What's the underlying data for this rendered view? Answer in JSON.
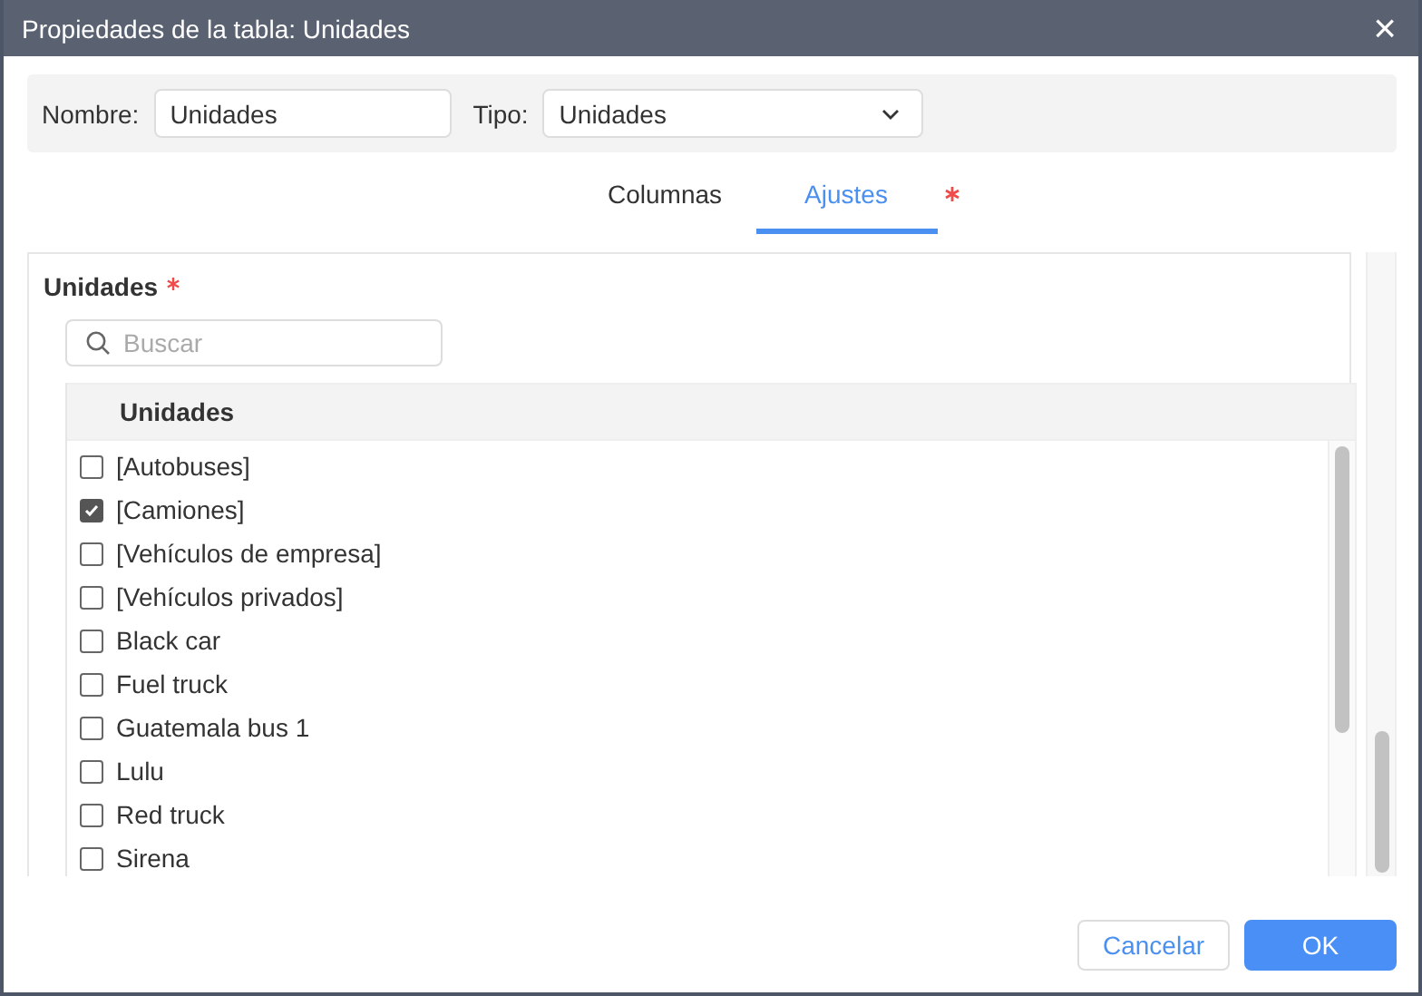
{
  "window": {
    "title": "Propiedades de la tabla: Unidades",
    "close": "×"
  },
  "fields": {
    "name_label": "Nombre:",
    "name_value": "Unidades",
    "type_label": "Tipo:",
    "type_value": "Unidades"
  },
  "tabs": [
    {
      "label": "Columnas",
      "selected": false,
      "required": false
    },
    {
      "label": "Ajustes",
      "selected": true,
      "required": true
    }
  ],
  "section": {
    "title": "Unidades",
    "required": true
  },
  "search": {
    "placeholder": "Buscar"
  },
  "table": {
    "column": "Unidades",
    "rows": [
      {
        "label": "[Autobuses]",
        "checked": false
      },
      {
        "label": "[Camiones]",
        "checked": true
      },
      {
        "label": "[Vehículos de empresa]",
        "checked": false
      },
      {
        "label": "[Vehículos privados]",
        "checked": false
      },
      {
        "label": "Black car",
        "checked": false
      },
      {
        "label": "Fuel truck",
        "checked": false
      },
      {
        "label": "Guatemala bus 1",
        "checked": false
      },
      {
        "label": "Lulu",
        "checked": false
      },
      {
        "label": "Red truck",
        "checked": false
      },
      {
        "label": "Sirena",
        "checked": false
      }
    ]
  },
  "buttons": [
    {
      "label": "Cancelar",
      "kind": "secondary"
    },
    {
      "label": "OK",
      "kind": "primary"
    }
  ]
}
